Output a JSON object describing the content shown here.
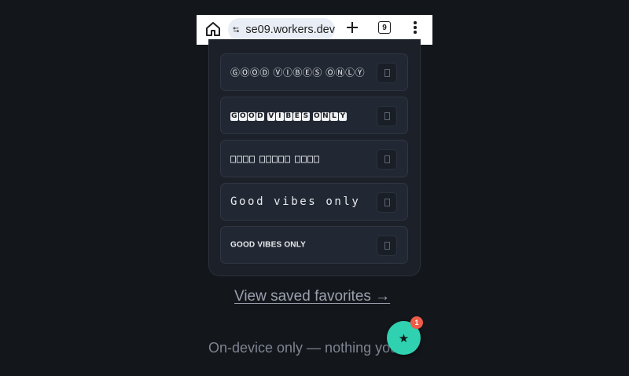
{
  "browser": {
    "url": "se09.workers.dev",
    "tab_count": "9",
    "icons": [
      "home-icon",
      "site-settings-icon",
      "new-tab-icon",
      "tab-switcher-icon",
      "more-menu-icon"
    ]
  },
  "styles": [
    {
      "id": "circled",
      "sample": "ⒼⓄⓄⒹ ⓋⒾⒷⒺⓈ ⓄⓃⓁⓎ"
    },
    {
      "id": "squared",
      "sample_words": [
        "GOOD",
        "VIBES",
        "ONLY"
      ]
    },
    {
      "id": "unsupported",
      "sample_words": [
        4,
        5,
        4
      ]
    },
    {
      "id": "spaced",
      "sample": "Good vibes only"
    },
    {
      "id": "bold",
      "sample": "GOOD VIBES ONLY"
    }
  ],
  "links": {
    "saved_favorites": "View saved favorites →"
  },
  "footer": {
    "note": "On-device only — nothing you"
  },
  "fab": {
    "icon": "★",
    "badge": "1",
    "color": "#2fd1b0",
    "badge_color": "#ef5b47"
  }
}
